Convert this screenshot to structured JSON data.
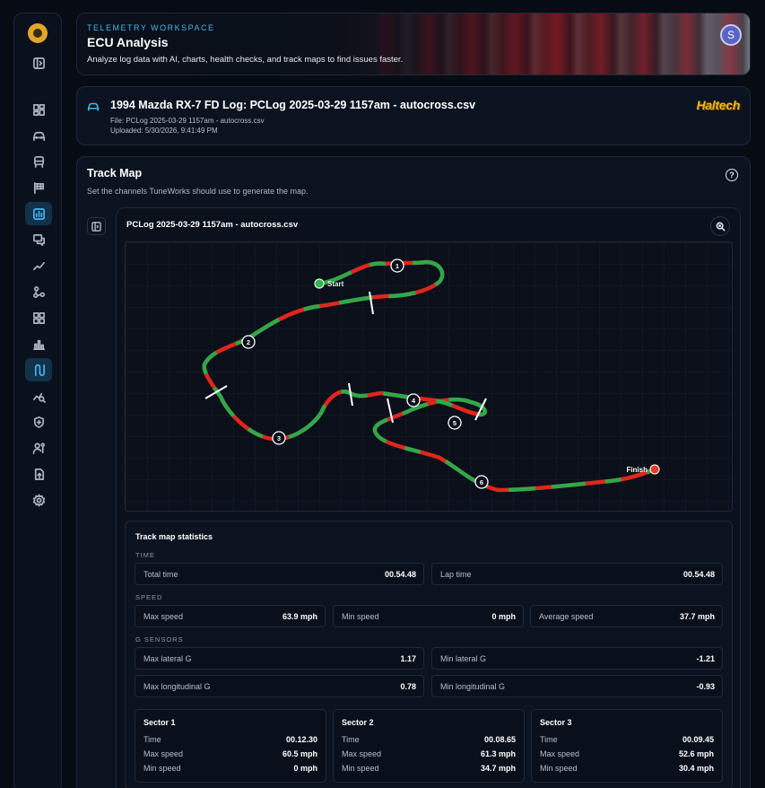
{
  "sidebar": {
    "items": [
      {
        "name": "dashboard-icon"
      },
      {
        "name": "car-icon"
      },
      {
        "name": "vehicle-front-icon"
      },
      {
        "name": "checkered-flag-icon"
      },
      {
        "name": "ecu-analysis-icon",
        "active": true
      },
      {
        "name": "chat-icon"
      },
      {
        "name": "trend-icon"
      },
      {
        "name": "nodes-icon"
      },
      {
        "name": "grid-icon"
      },
      {
        "name": "bar-chart-icon"
      },
      {
        "name": "track-route-icon",
        "active": true
      },
      {
        "name": "chart-search-icon"
      },
      {
        "name": "shield-icon"
      },
      {
        "name": "user-settings-icon"
      },
      {
        "name": "file-upload-icon"
      },
      {
        "name": "gear-icon"
      }
    ]
  },
  "hero": {
    "eyebrow": "TELEMETRY WORKSPACE",
    "title": "ECU Analysis",
    "subtitle": "Analyze log data with AI, charts, health checks, and track maps to find issues faster.",
    "avatar_initial": "S"
  },
  "log": {
    "title": "1994 Mazda RX-7 FD Log: PCLog 2025-03-29 1157am - autocross.csv",
    "file": "File: PCLog 2025-03-29 1157am - autocross.csv",
    "uploaded": "Uploaded: 5/30/2026, 9:41:49 PM",
    "brand": "Haltech"
  },
  "track_map": {
    "title": "Track Map",
    "subtitle": "Set the channels TuneWorks should use to generate the map.",
    "map_title": "PCLog 2025-03-29 1157am - autocross.csv",
    "start_label": "Start",
    "finish_label": "Finish",
    "markers": [
      "1",
      "2",
      "3",
      "4",
      "5",
      "6"
    ]
  },
  "stats": {
    "title": "Track map statistics",
    "time_label": "TIME",
    "speed_label": "SPEED",
    "g_label": "G SENSORS",
    "total_time": {
      "label": "Total time",
      "value": "00.54.48"
    },
    "lap_time": {
      "label": "Lap time",
      "value": "00.54.48"
    },
    "max_speed": {
      "label": "Max speed",
      "value": "63.9 mph"
    },
    "min_speed": {
      "label": "Min speed",
      "value": "0 mph"
    },
    "avg_speed": {
      "label": "Average speed",
      "value": "37.7 mph"
    },
    "max_lat": {
      "label": "Max lateral G",
      "value": "1.17"
    },
    "min_lat": {
      "label": "Min lateral G",
      "value": "-1.21"
    },
    "max_long": {
      "label": "Max longitudinal G",
      "value": "0.78"
    },
    "min_long": {
      "label": "Min longitudinal G",
      "value": "-0.93"
    },
    "sectors": [
      {
        "name": "Sector 1",
        "time_label": "Time",
        "time": "00.12.30",
        "max_label": "Max speed",
        "max": "60.5 mph",
        "min_label": "Min speed",
        "min": "0 mph"
      },
      {
        "name": "Sector 2",
        "time_label": "Time",
        "time": "00.08.65",
        "max_label": "Max speed",
        "max": "61.3 mph",
        "min_label": "Min speed",
        "min": "34.7 mph"
      },
      {
        "name": "Sector 3",
        "time_label": "Time",
        "time": "00.09.45",
        "max_label": "Max speed",
        "max": "52.6 mph",
        "min_label": "Min speed",
        "min": "30.4 mph"
      }
    ]
  },
  "colors": {
    "accent": "#46b4f0",
    "fast": "#2fa84a",
    "slow": "#e0261c",
    "start": "#34b24a",
    "finish": "#e23b2a"
  }
}
